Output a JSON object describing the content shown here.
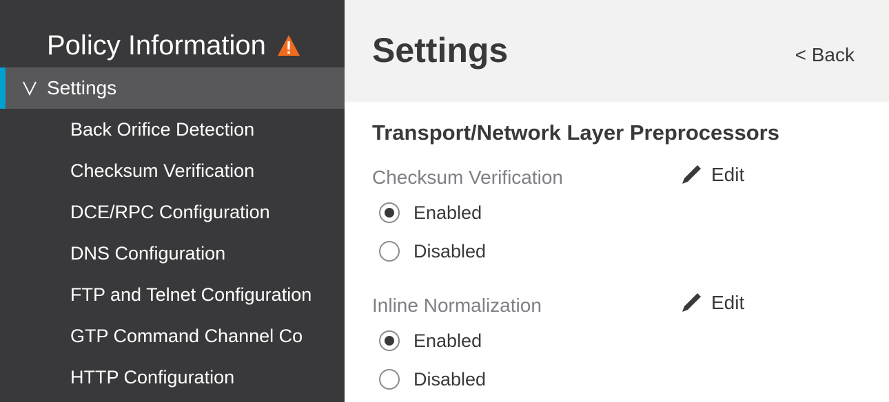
{
  "sidebar": {
    "title": "Policy Information",
    "warning_icon": "warning-triangle-icon",
    "warning_color": "#f26b1d",
    "accent_color": "#00a0d1",
    "settings_label": "Settings",
    "items": [
      {
        "label": "Back Orifice Detection"
      },
      {
        "label": "Checksum Verification"
      },
      {
        "label": "DCE/RPC Configuration"
      },
      {
        "label": "DNS Configuration"
      },
      {
        "label": "FTP and Telnet Configuration"
      },
      {
        "label": "GTP Command Channel Co"
      },
      {
        "label": "HTTP Configuration"
      }
    ]
  },
  "header": {
    "title": "Settings",
    "back_label": "< Back"
  },
  "main": {
    "section_title": "Transport/Network Layer Preprocessors",
    "groups": [
      {
        "label": "Checksum Verification",
        "edit_label": "Edit",
        "options": [
          {
            "label": "Enabled",
            "checked": true
          },
          {
            "label": "Disabled",
            "checked": false
          }
        ]
      },
      {
        "label": "Inline Normalization",
        "edit_label": "Edit",
        "options": [
          {
            "label": "Enabled",
            "checked": true
          },
          {
            "label": "Disabled",
            "checked": false
          }
        ]
      }
    ]
  }
}
